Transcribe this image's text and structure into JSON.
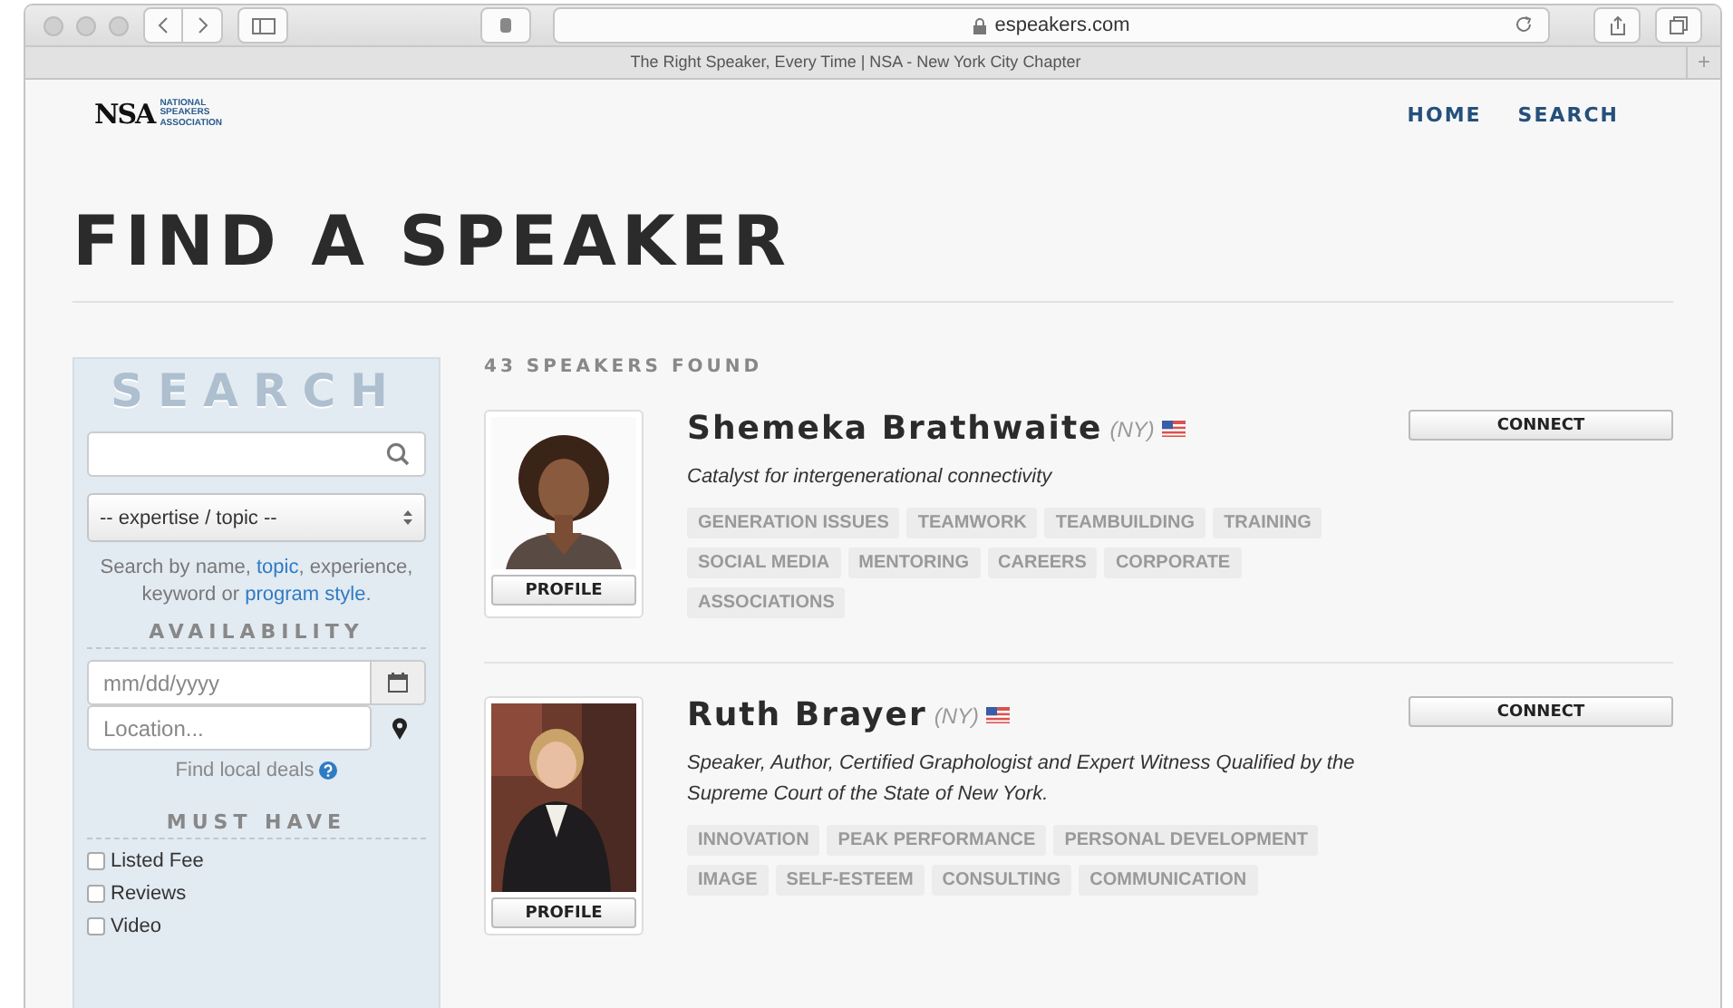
{
  "browser": {
    "url": "espeakers.com",
    "tab_title": "The Right Speaker, Every Time | NSA - New York City Chapter",
    "new_tab": "+"
  },
  "header": {
    "logo": {
      "mark": "NSA",
      "lines": [
        "NATIONAL",
        "SPEAKERS",
        "ASSOCIATION"
      ]
    },
    "nav": [
      {
        "label": "HOME"
      },
      {
        "label": "SEARCH"
      }
    ]
  },
  "heading": "FIND A SPEAKER",
  "sidebar": {
    "title": "SEARCH",
    "select": "-- expertise / topic --",
    "help": [
      {
        "text": "Search by name, ",
        "link": false
      },
      {
        "text": "topic",
        "link": true
      },
      {
        "text": ", experience, keyword or ",
        "link": false
      },
      {
        "text": "program style",
        "link": true
      },
      {
        "text": ".",
        "link": false
      }
    ],
    "availability_title": "AVAILABILITY",
    "date_placeholder": "mm/dd/yyyy",
    "location_placeholder": "Location...",
    "local_deals": "Find local deals",
    "must_have_title": "MUST HAVE",
    "filters": [
      {
        "label": "Listed Fee",
        "checked": false
      },
      {
        "label": "Reviews",
        "checked": false
      },
      {
        "label": "Video",
        "checked": false
      }
    ]
  },
  "results": {
    "count": "43 SPEAKERS FOUND",
    "speakers": [
      {
        "name": "Shemeka Brathwaite",
        "state": "(NY)",
        "tagline": "Catalyst for intergenerational connectivity",
        "tags": [
          "GENERATION ISSUES",
          "TEAMWORK",
          "TEAMBUILDING",
          "TRAINING",
          "SOCIAL MEDIA",
          "MENTORING",
          "CAREERS",
          "CORPORATE",
          "ASSOCIATIONS"
        ],
        "profile": "PROFILE",
        "connect": "CONNECT"
      },
      {
        "name": "Ruth Brayer",
        "state": "(NY)",
        "tagline": "Speaker, Author, Certified Graphologist and Expert Witness Qualified by the Supreme Court of the State of New York.",
        "tags": [
          "INNOVATION",
          "PEAK PERFORMANCE",
          "PERSONAL DEVELOPMENT",
          "IMAGE",
          "SELF-ESTEEM",
          "CONSULTING",
          "COMMUNICATION"
        ],
        "profile": "PROFILE",
        "connect": "CONNECT"
      }
    ]
  }
}
